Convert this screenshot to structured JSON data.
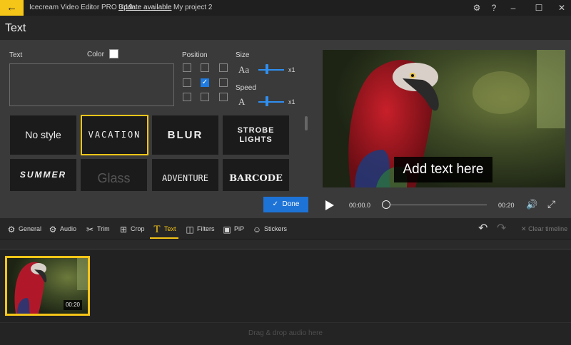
{
  "titlebar": {
    "back_icon": "arrow-left-icon",
    "app_title": "Icecream Video Editor PRO 3.19",
    "update_link": "Update available",
    "project_name": "My project 2",
    "settings_icon": "gear-icon",
    "help_label": "?",
    "minimize_label": "–",
    "maximize_label": "☐",
    "close_label": "✕"
  },
  "header": {
    "title": "Text"
  },
  "text_panel": {
    "text_label": "Text",
    "text_value": "",
    "color_label": "Color",
    "color_value": "#ffffff",
    "position_label": "Position",
    "position_selected": "center",
    "size_label": "Size",
    "size_icon_label": "Aa",
    "size_multiplier": "x1",
    "speed_label": "Speed",
    "speed_icon_label": "A",
    "speed_multiplier": "x1",
    "styles": [
      {
        "label": "No style"
      },
      {
        "label": "VACATION"
      },
      {
        "label": "BLUR"
      },
      {
        "label": "STROBE"
      },
      {
        "label": "LIGHTS"
      },
      {
        "label": "SUMMER"
      },
      {
        "label": "Glass"
      },
      {
        "label": "ADVENTURE"
      },
      {
        "label": "BARCODE"
      }
    ],
    "selected_style": "VACATION",
    "done_label": "Done"
  },
  "preview": {
    "overlay_text": "Add text here",
    "current_time": "00:00.0",
    "duration": "00:20",
    "progress": 0
  },
  "toolbar": {
    "tools": [
      {
        "label": "General",
        "icon": "gear-icon"
      },
      {
        "label": "Audio",
        "icon": "gear-icon"
      },
      {
        "label": "Trim",
        "icon": "scissors-icon"
      },
      {
        "label": "Crop",
        "icon": "crop-icon"
      },
      {
        "label": "Text",
        "icon": "text-t-icon"
      },
      {
        "label": "Filters",
        "icon": "filters-icon"
      },
      {
        "label": "PiP",
        "icon": "pip-icon"
      },
      {
        "label": "Stickers",
        "icon": "smiley-icon"
      }
    ],
    "active_tool": "Text",
    "clear_label": "Clear timeline"
  },
  "timeline": {
    "clip_duration": "00:20",
    "audio_hint": "Drag & drop audio here"
  },
  "colors": {
    "accent": "#f5c518",
    "primary_button": "#1e73d6",
    "checkbox": "#1f7be0"
  }
}
